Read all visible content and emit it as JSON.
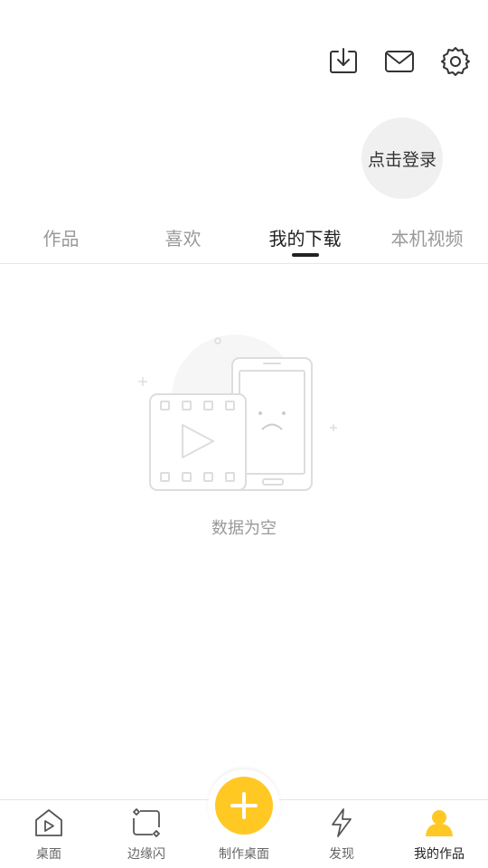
{
  "header": {
    "icons": [
      "download-icon",
      "mail-icon",
      "settings-icon"
    ],
    "login_label": "点击登录"
  },
  "tabs": [
    {
      "label": "作品",
      "active": false
    },
    {
      "label": "喜欢",
      "active": false
    },
    {
      "label": "我的下载",
      "active": true
    },
    {
      "label": "本机视频",
      "active": false
    }
  ],
  "empty_state": {
    "icon": "empty-video-phone-illustration",
    "text": "数据为空"
  },
  "bottom_nav": [
    {
      "label": "桌面",
      "icon": "home-play-icon",
      "active": false
    },
    {
      "label": "边缘闪",
      "icon": "edge-flash-icon",
      "active": false
    },
    {
      "label": "制作桌面",
      "icon": "plus-icon",
      "active": false
    },
    {
      "label": "发现",
      "icon": "lightning-icon",
      "active": false
    },
    {
      "label": "我的作品",
      "icon": "user-icon",
      "active": true
    }
  ],
  "colors": {
    "accent": "#ffc823",
    "active_text": "#222222",
    "inactive_text": "#999999"
  }
}
